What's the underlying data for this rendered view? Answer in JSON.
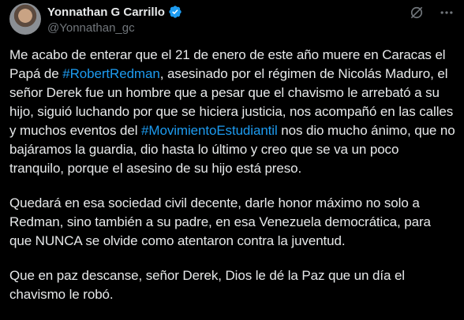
{
  "author": {
    "display_name": "Yonnathan G Carrillo",
    "handle": "@Yonnathan_gc"
  },
  "icons": {
    "verified": "verified-badge-icon",
    "grok": "grok-icon",
    "more": "more-options-icon"
  },
  "colors": {
    "background": "#000000",
    "text": "#e7e9ea",
    "secondary": "#71767b",
    "accent": "#1d9bf0"
  },
  "tweet": {
    "p1_a": "Me acabo de enterar que el 21 de enero de este año muere en Caracas el Papá de ",
    "p1_tag1": "#RobertRedman",
    "p1_b": ", asesinado por el régimen de Nicolás Maduro, el señor Derek fue un hombre que a pesar que el chavismo le arrebató a su hijo, siguió luchando por que se hiciera justicia, nos acompañó en las calles y muchos eventos del ",
    "p1_tag2": "#MovimientoEstudiantil",
    "p1_c": " nos dio mucho ánimo, que no bajáramos la guardia, dio hasta lo último y creo que se va un poco tranquilo, porque el asesino de su hijo está preso.",
    "p2": "Quedará en esa sociedad civil decente, darle honor máximo no solo a Redman, sino también a su padre, en esa Venezuela democrática, para que NUNCA se olvide como atentaron contra la juventud.",
    "p3": "Que en paz descanse, señor Derek, Dios le dé la Paz que un día el chavismo le robó."
  }
}
